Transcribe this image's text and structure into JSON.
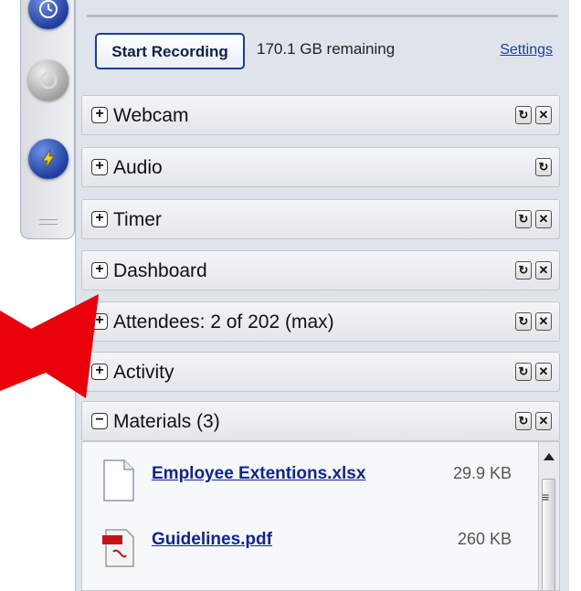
{
  "recording": {
    "start_label": "Start Recording",
    "remaining": "170.1 GB remaining",
    "settings_label": "Settings"
  },
  "sections": [
    {
      "label": "Webcam",
      "expander": "+",
      "refresh": "↻",
      "close": "✕"
    },
    {
      "label": "Audio",
      "expander": "+",
      "refresh": "↻"
    },
    {
      "label": "Timer",
      "expander": "+",
      "refresh": "↻",
      "close": "✕"
    },
    {
      "label": "Dashboard",
      "expander": "+",
      "refresh": "↻",
      "close": "✕"
    },
    {
      "label": "Attendees:  2 of 202 (max)",
      "expander": "+",
      "refresh": "↻",
      "close": "✕"
    },
    {
      "label": "Activity",
      "expander": "+",
      "refresh": "↻",
      "close": "✕"
    },
    {
      "label": "Materials (3)",
      "expander": "−",
      "refresh": "↻",
      "close": "✕"
    }
  ],
  "materials": [
    {
      "name": "Employee Extentions.xlsx",
      "size": "29.9 KB",
      "icon": "document-icon"
    },
    {
      "name": "Guidelines.pdf",
      "size": "260 KB",
      "icon": "pdf-icon"
    }
  ],
  "scrollbar": {
    "grip": "≡"
  },
  "colors": {
    "accent_blue": "#1f3ea0",
    "link_blue": "#10249a",
    "arrow_red": "#e8000b",
    "panel_bg": "#dfe4ea"
  },
  "icons": {
    "dock_top": "meeting-icon",
    "dock_mid": "disabled-circle-icon",
    "dock_bot": "lightning-icon"
  }
}
